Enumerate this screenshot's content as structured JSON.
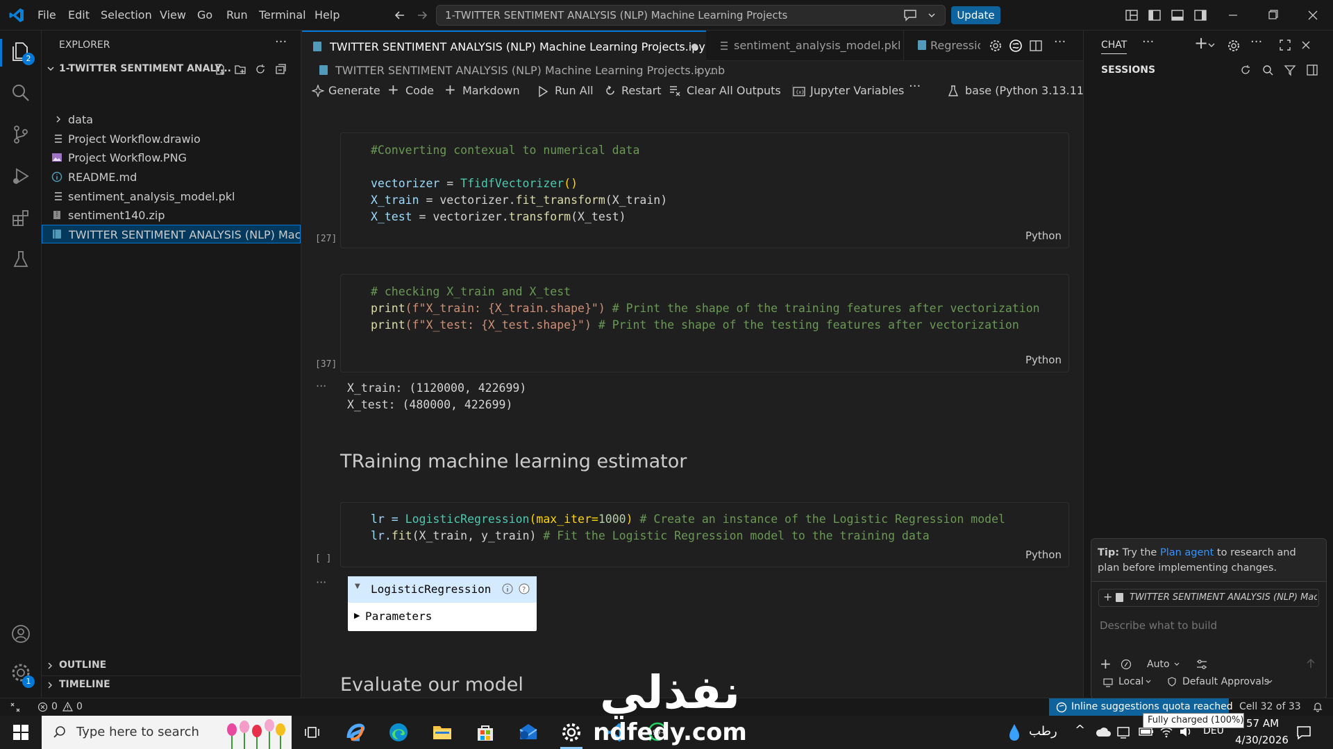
{
  "menu": [
    "File",
    "Edit",
    "Selection",
    "View",
    "Go",
    "Run",
    "Terminal",
    "Help"
  ],
  "command_center": "1-TWITTER SENTIMENT ANALYSIS (NLP) Machine Learning Projects",
  "update_label": "Update",
  "activity_badges": {
    "explorer": "2",
    "settings": "1"
  },
  "explorer": {
    "header": "EXPLORER",
    "root": "1-TWITTER SENTIMENT ANALY...",
    "items": [
      {
        "label": "data",
        "type": "folder"
      },
      {
        "label": "Project Workflow.drawio",
        "type": "file"
      },
      {
        "label": "Project Workflow.PNG",
        "type": "image"
      },
      {
        "label": "README.md",
        "type": "info"
      },
      {
        "label": "sentiment_analysis_model.pkl",
        "type": "file"
      },
      {
        "label": "sentiment140.zip",
        "type": "zip"
      },
      {
        "label": "TWITTER SENTIMENT ANALYSIS (NLP)  Machi...",
        "type": "notebook",
        "selected": true
      }
    ],
    "outline": "OUTLINE",
    "timeline": "TIMELINE"
  },
  "tabs": [
    {
      "label": "TWITTER SENTIMENT ANALYSIS (NLP) Machine Learning Projects.ipynb",
      "active": true,
      "dirty": true
    },
    {
      "label": "sentiment_analysis_model.pkl",
      "active": false
    },
    {
      "label": "Regressio",
      "active": false
    }
  ],
  "breadcrumb": "TWITTER SENTIMENT ANALYSIS (NLP)  Machine Learning Projects.ipynb",
  "breadcrumb_tail": "...",
  "toolbar": {
    "generate": "Generate",
    "code": "Code",
    "markdown": "Markdown",
    "run_all": "Run All",
    "restart": "Restart",
    "clear_outputs": "Clear All Outputs",
    "variables": "Jupyter Variables",
    "kernel": "base (Python 3.13.11)"
  },
  "cells": {
    "c1": {
      "exec": "[27]",
      "lang": "Python",
      "l1": "#Converting contexual to numerical data",
      "l2a": "vectorizer",
      "l2b": " = ",
      "l2c": "TfidfVectorizer",
      "l2d": "()",
      "l3a": "X_train",
      "l3b": " = vectorizer.",
      "l3c": "fit_transform",
      "l3d": "(X_train)",
      "l4a": "X_test",
      "l4b": " = vectorizer.",
      "l4c": "transform",
      "l4d": "(X_test)"
    },
    "c2": {
      "exec": "[37]",
      "lang": "Python",
      "l1": "# checking X_train and X_test",
      "l2a": "print",
      "l2b": "(f\"X_train: {X_train.shape}\")",
      "l2c": " # Print the shape of the training features after vectorization",
      "l3a": "print",
      "l3b": "(f\"X_test: {X_test.shape}\")",
      "l3c": " # Print the shape of the testing features after vectorization",
      "out1": "X_train: (1120000, 422699)",
      "out2": "X_test: (480000, 422699)"
    },
    "md1": "TRaining machine learning estimator",
    "c3": {
      "exec": "[ ]",
      "lang": "Python",
      "l1a": "lr = ",
      "l1b": "LogisticRegression",
      "l1c": "(max_iter=",
      "l1d": "1000",
      "l1e": ")",
      "l1f": " # Create an instance of the Logistic Regression model",
      "l2a": "lr.",
      "l2b": "fit",
      "l2c": "(X_train, y_train)",
      "l2d": " # Fit the Logistic Regression model to the training data",
      "widget_title": "LogisticRegression",
      "widget_params": "Parameters"
    },
    "md2": "Evaluate our model"
  },
  "chat": {
    "header": "CHAT",
    "sessions": "SESSIONS",
    "tip_prefix": "Tip:",
    "tip_a": " Try the ",
    "tip_link": "Plan agent",
    "tip_b": " to research and plan before implementing changes.",
    "context_file": "TWITTER SENTIMENT ANALYSIS (NLP) Machi",
    "placeholder": "Describe what to build",
    "mode": "Auto",
    "local": "Local",
    "approvals": "Default Approvals"
  },
  "status": {
    "errors": "0",
    "warnings": "0",
    "quota": "Inline suggestions quota reached",
    "cell": "Cell 32 of 33",
    "tooltip": "Fully charged (100%)"
  },
  "taskbar": {
    "search": "Type here to search",
    "weather": "رطب",
    "lang": "DEU",
    "time": "57 AM",
    "date": "4/30/2026"
  },
  "watermark": {
    "arabic": "نفذلي",
    "latin": "ndfedy.com"
  },
  "colors": {
    "accent": "#0078d4",
    "update": "#0e639c",
    "quota": "#0e639c"
  }
}
